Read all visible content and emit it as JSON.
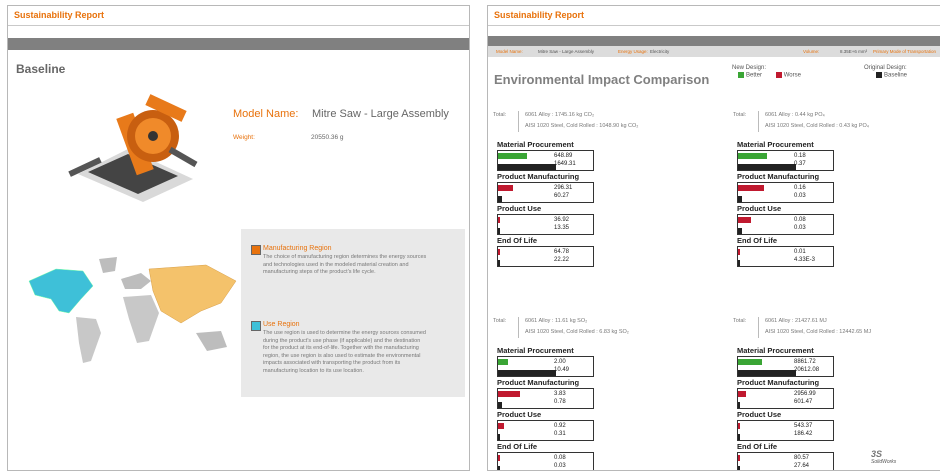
{
  "p1": {
    "header": "Sustainability Report",
    "baseline": "Baseline",
    "model_label": "Model Name:",
    "model_value": "Mitre Saw - Large Assembly",
    "weight_label": "Weight:",
    "weight_value": "20550.36 g",
    "manufacturing_title": "Manufacturing Region",
    "manufacturing_lines": [
      "The choice of manufacturing region determines the energy sources",
      "and technologies used in the modeled material creation and",
      "manufacturing steps of the product's life cycle."
    ],
    "use_title": "Use Region",
    "use_lines": [
      "The use region is used to determine the energy sources consumed",
      "during the product's use phase (if applicable) and the destination",
      "for the product at its end-of-life. Together with the manufacturing",
      "region, the use region is also used to estimate the environmental",
      "impacts associated with transporting the product from its",
      "manufacturing location to its use location."
    ]
  },
  "p2": {
    "header": "Sustainability Report",
    "tabs": [
      "Model Name:",
      "Mitre Saw - Large Assembly",
      "Energy Usage:",
      "Electricity",
      "Volume:",
      "8.35E+6 mm³",
      "Primary Mode of Transportation"
    ],
    "title": "Environmental Impact Comparison",
    "new_design": "New Design:",
    "better": "Better",
    "worse": "Worse",
    "original_design": "Original Design:",
    "baseline": "Baseline",
    "total_label": "Total:",
    "panels": [
      {
        "t1": "6061 Alloy : 1745.16 kg CO₂",
        "t2": "AISI 1020 Steel, Cold Rolled : 1048.90 kg CO₂",
        "cats": [
          {
            "name": "Material Procurement",
            "a": "648.89",
            "b": "1649.31",
            "c": "g",
            "fa": 0.3,
            "fb": 0.6
          },
          {
            "name": "Product Manufacturing",
            "a": "296.31",
            "b": "60.27",
            "c": "r",
            "fa": 0.15,
            "fb": 0.04
          },
          {
            "name": "Product Use",
            "a": "36.92",
            "b": "13.35",
            "c": "r",
            "fa": 0.02,
            "fb": 0.015
          },
          {
            "name": "End Of Life",
            "a": "64.78",
            "b": "22.22",
            "c": "r",
            "fa": 0.02,
            "fb": 0.015
          }
        ]
      },
      {
        "t1": "6061 Alloy : 0.44 kg PO₄",
        "t2": "AISI 1020 Steel, Cold Rolled : 0.43 kg PO₄",
        "cats": [
          {
            "name": "Material Procurement",
            "a": "0.18",
            "b": "0.37",
            "c": "g",
            "fa": 0.3,
            "fb": 0.6
          },
          {
            "name": "Product Manufacturing",
            "a": "0.16",
            "b": "0.03",
            "c": "r",
            "fa": 0.27,
            "fb": 0.04
          },
          {
            "name": "Product Use",
            "a": "0.08",
            "b": "0.03",
            "c": "r",
            "fa": 0.13,
            "fb": 0.04
          },
          {
            "name": "End Of Life",
            "a": "0.01",
            "b": "4.33E-3",
            "c": "r",
            "fa": 0.02,
            "fb": 0.015
          }
        ]
      },
      {
        "t1": "6061 Alloy : 11.61 kg SO₂",
        "t2": "AISI 1020 Steel, Cold Rolled : 6.83 kg SO₂",
        "cats": [
          {
            "name": "Material Procurement",
            "a": "2.00",
            "b": "10.49",
            "c": "g",
            "fa": 0.1,
            "fb": 0.6
          },
          {
            "name": "Product Manufacturing",
            "a": "3.83",
            "b": "0.78",
            "c": "r",
            "fa": 0.23,
            "fb": 0.04
          },
          {
            "name": "Product Use",
            "a": "0.92",
            "b": "0.31",
            "c": "r",
            "fa": 0.06,
            "fb": 0.02
          },
          {
            "name": "End Of Life",
            "a": "0.08",
            "b": "0.03",
            "c": "r",
            "fa": 0.02,
            "fb": 0.015
          }
        ]
      },
      {
        "t1": "6061 Alloy : 21427.61 MJ",
        "t2": "AISI 1020 Steel, Cold Rolled : 12442.65 MJ",
        "cats": [
          {
            "name": "Material Procurement",
            "a": "8861.72",
            "b": "20612.08",
            "c": "g",
            "fa": 0.25,
            "fb": 0.6
          },
          {
            "name": "Product Manufacturing",
            "a": "2956.99",
            "b": "601.47",
            "c": "r",
            "fa": 0.08,
            "fb": 0.02
          },
          {
            "name": "Product Use",
            "a": "543.37",
            "b": "186.42",
            "c": "r",
            "fa": 0.02,
            "fb": 0.015
          },
          {
            "name": "End Of Life",
            "a": "80.57",
            "b": "27.64",
            "c": "r",
            "fa": 0.02,
            "fb": 0.015
          }
        ]
      }
    ],
    "logo": "SolidWorks",
    "colors": {
      "better": "#3aa535",
      "worse": "#c0192f",
      "baseline": "#222222",
      "accent": "#e8720c"
    }
  }
}
